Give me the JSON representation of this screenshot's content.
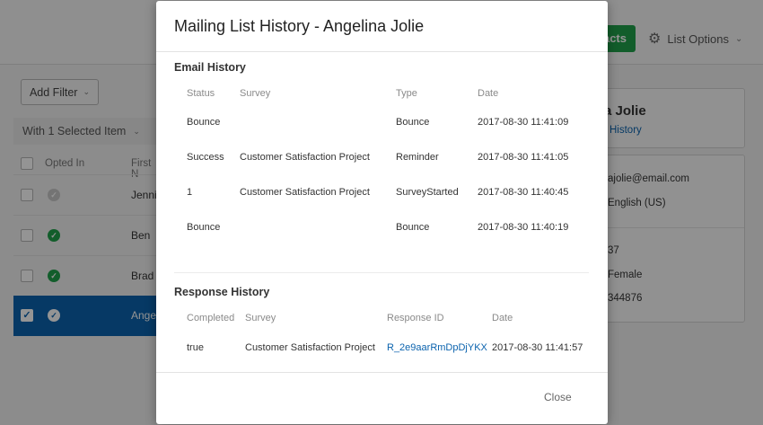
{
  "background": {
    "contacts_button_label": "acts",
    "list_options_label": "List Options",
    "add_filter_label": "Add Filter",
    "selected_bar_label": "With 1 Selected Item",
    "table": {
      "headers": {
        "opted_in": "Opted In",
        "first_name": "First N"
      },
      "rows": [
        {
          "name": "Jenni",
          "status": "grey",
          "selected": false
        },
        {
          "name": "Ben",
          "status": "green",
          "selected": false
        },
        {
          "name": "Brad",
          "status": "green",
          "selected": false
        },
        {
          "name": "Angel",
          "status": "green",
          "selected": true
        }
      ]
    },
    "panel": {
      "name": "a Jolie",
      "history_link": "History",
      "email": "ajolie@email.com",
      "language": "English (US)",
      "field1": "37",
      "gender": "Female",
      "phone": "344876"
    }
  },
  "modal": {
    "title": "Mailing List History - Angelina Jolie",
    "email_history": {
      "title": "Email History",
      "columns": {
        "status": "Status",
        "survey": "Survey",
        "type": "Type",
        "date": "Date"
      },
      "rows": [
        {
          "status": "Bounce",
          "survey": "",
          "type": "Bounce",
          "date": "2017-08-30 11:41:09"
        },
        {
          "status": "Success",
          "survey": "Customer Satisfaction Project",
          "type": "Reminder",
          "date": "2017-08-30 11:41:05"
        },
        {
          "status": "1",
          "survey": "Customer Satisfaction Project",
          "type": "SurveyStarted",
          "date": "2017-08-30 11:40:45"
        },
        {
          "status": "Bounce",
          "survey": "",
          "type": "Bounce",
          "date": "2017-08-30 11:40:19"
        }
      ]
    },
    "response_history": {
      "title": "Response History",
      "columns": {
        "completed": "Completed",
        "survey": "Survey",
        "response_id": "Response ID",
        "date": "Date"
      },
      "rows": [
        {
          "completed": "true",
          "survey": "Customer Satisfaction Project",
          "response_id": "R_2e9aarRmDpDjYKX",
          "date": "2017-08-30 11:41:57"
        }
      ]
    },
    "close_label": "Close"
  }
}
